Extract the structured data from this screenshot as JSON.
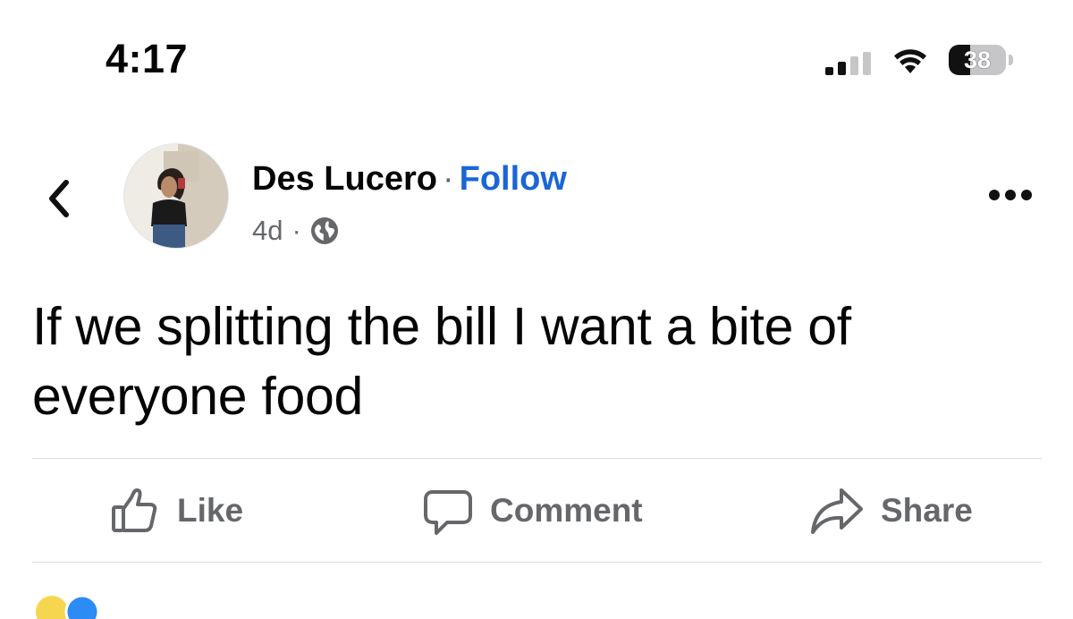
{
  "status_bar": {
    "time": "4:17",
    "battery_percent": "38",
    "battery_level": 0.38,
    "signal_bars_active": 2,
    "signal_bars_total": 4
  },
  "post": {
    "author": "Des Lucero",
    "separator": "·",
    "follow_label": "Follow",
    "age": "4d",
    "audience_icon": "globe-icon",
    "text": "If we splitting the bill I want a bite of everyone food"
  },
  "actions": {
    "like_label": "Like",
    "comment_label": "Comment",
    "share_label": "Share"
  },
  "colors": {
    "link_blue": "#1b66d6",
    "secondary_text": "#65676b",
    "divider": "#dadde1"
  }
}
